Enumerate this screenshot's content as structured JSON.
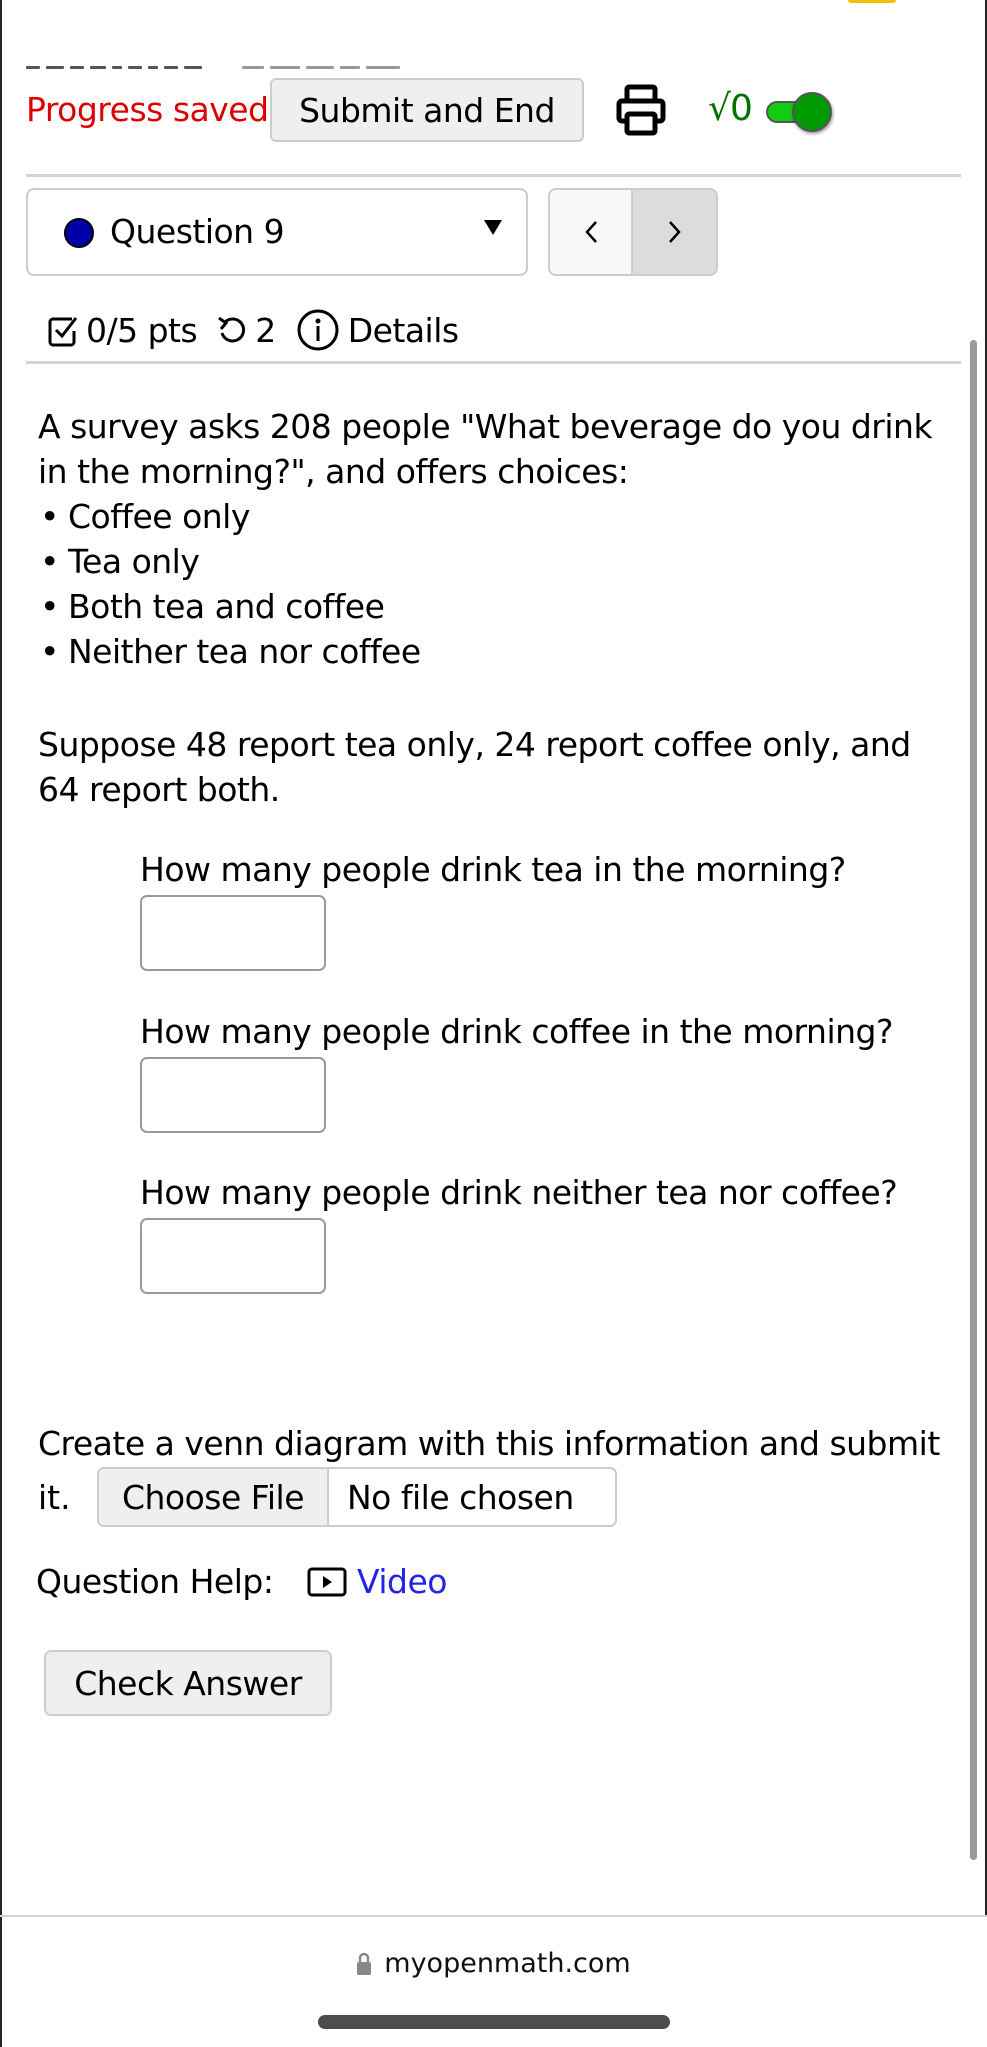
{
  "header": {
    "status_text": "Progress saved",
    "submit_label": "Submit and End",
    "print_icon": "printer-icon",
    "math_toggle_label": "√0",
    "math_toggle_state": "on"
  },
  "question_nav": {
    "current": "Question 9",
    "status_color": "#0000aa",
    "prev_symbol": "‹",
    "next_symbol": "›"
  },
  "meta": {
    "points": "0/5 pts",
    "retries": "2",
    "details_label": "Details"
  },
  "question": {
    "intro": "A survey asks 208 people \"What beverage do you drink in the morning?\", and offers choices:",
    "choices": [
      "Coffee only",
      "Tea only",
      "Both tea and coffee",
      "Neither tea nor coffee"
    ],
    "given": "Suppose 48 report tea only, 24 report coffee only, and 64 report both.",
    "parts": [
      {
        "prompt": "How many people drink tea in the morning?",
        "value": ""
      },
      {
        "prompt": "How many people drink coffee in the morning?",
        "value": ""
      },
      {
        "prompt": "How many people drink neither tea nor coffee?",
        "value": ""
      }
    ],
    "upload_text": "Create a venn diagram with this information and submit",
    "upload_text_end": "it.",
    "choose_file_label": "Choose File",
    "file_status": "No file chosen"
  },
  "help": {
    "label": "Question Help:",
    "video_label": "Video"
  },
  "check_answer_label": "Check Answer",
  "browser": {
    "domain": "myopenmath.com"
  },
  "colors": {
    "status_red": "#dd0000",
    "toggle_green": "#009900",
    "link_blue": "#2222ee"
  }
}
